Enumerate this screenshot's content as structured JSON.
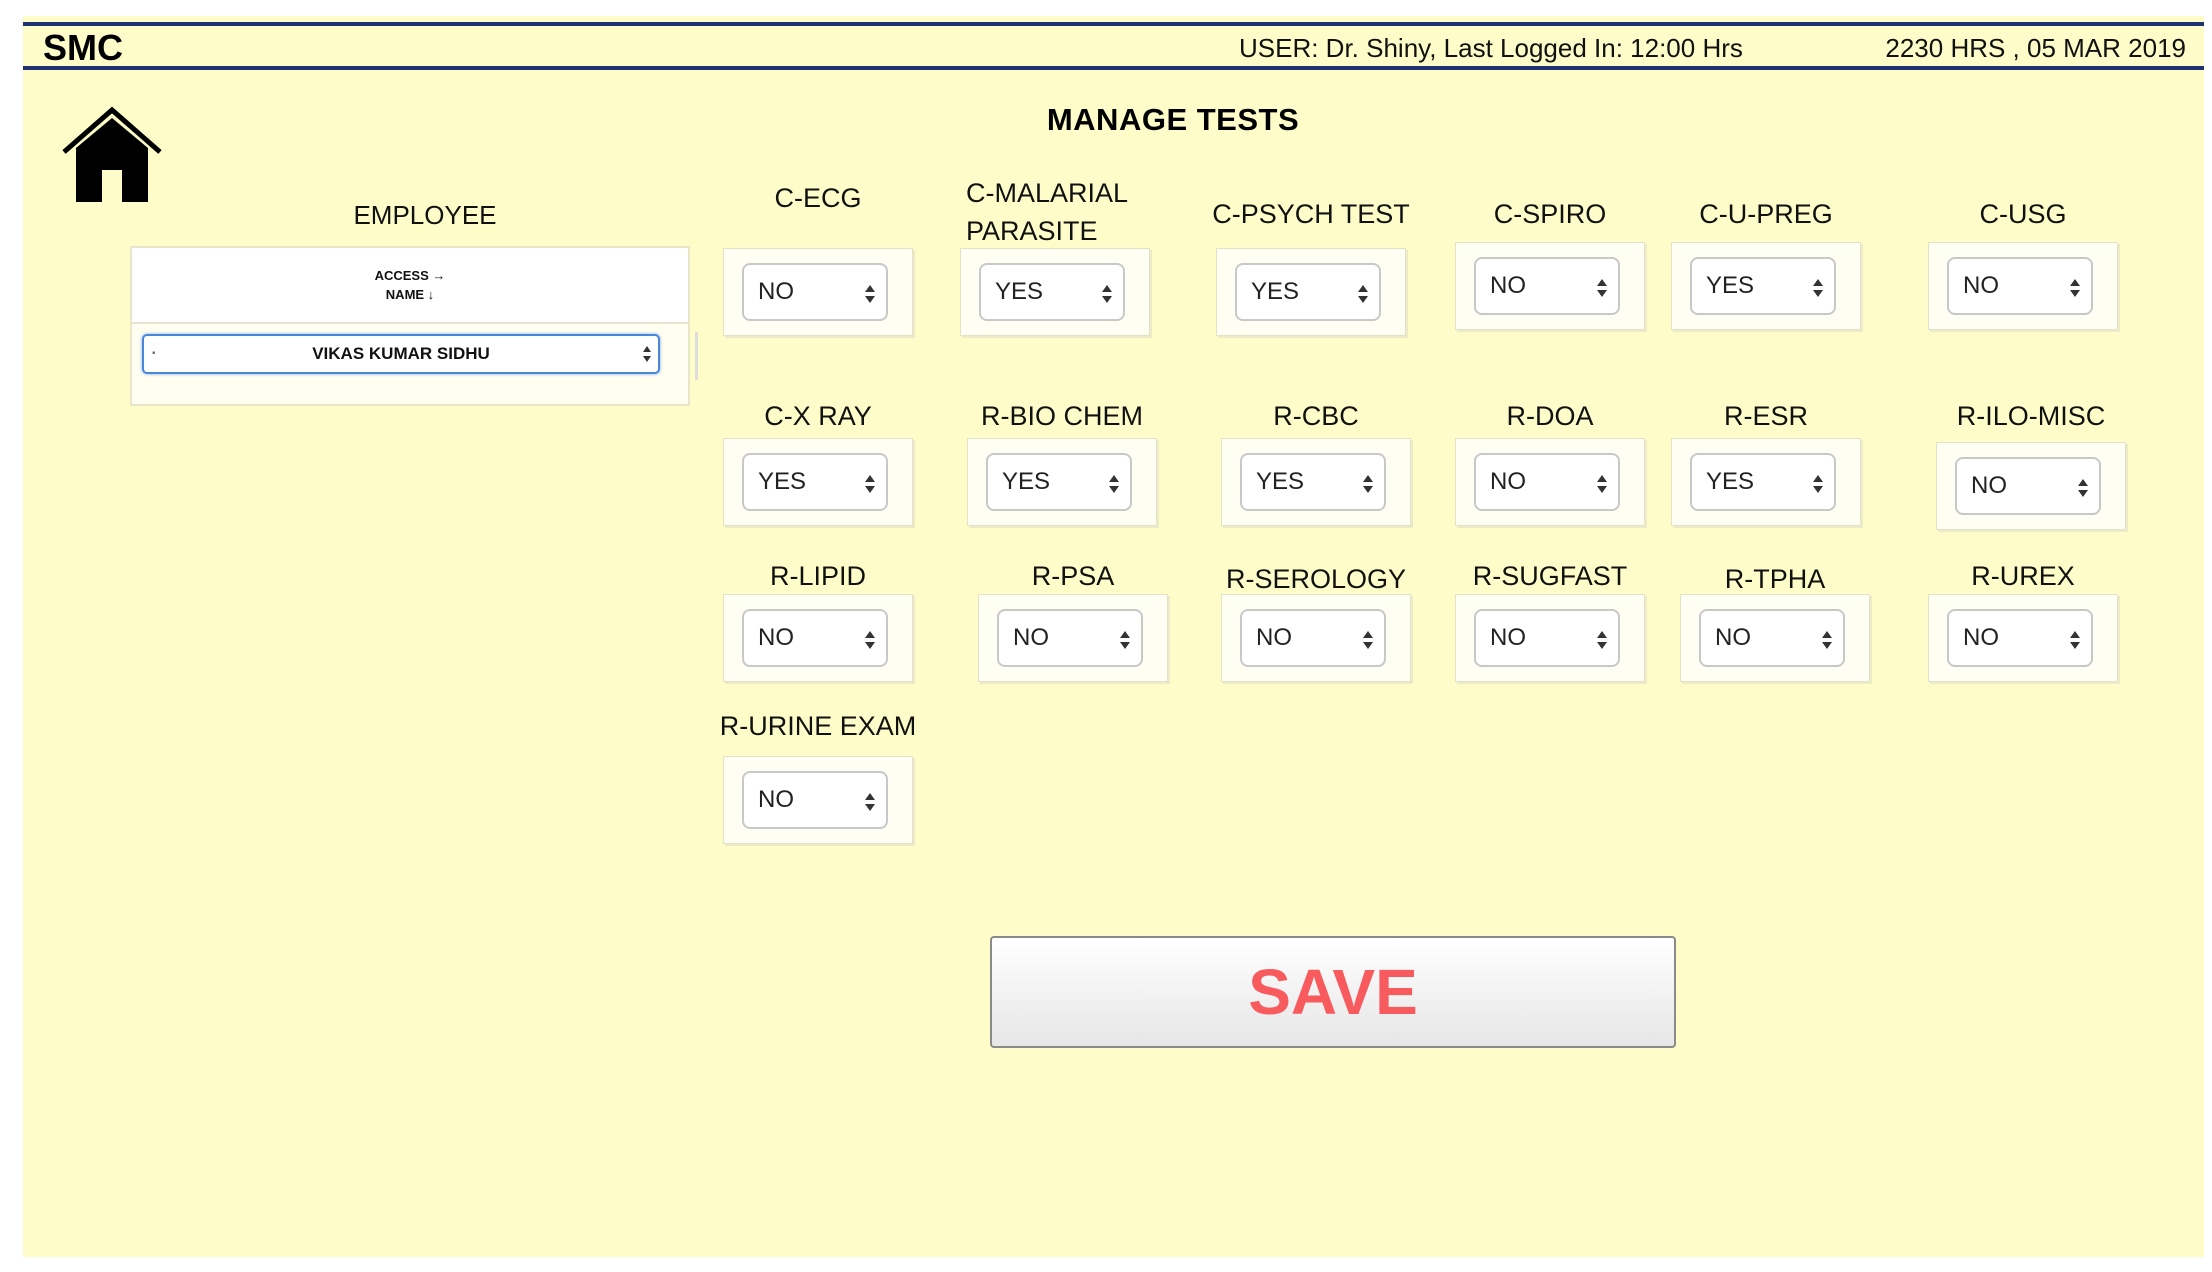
{
  "header": {
    "brand": "SMC",
    "user_info": "USER: Dr. Shiny, Last Logged In: 12:00 Hrs",
    "datetime": "2230 HRS , 05 MAR 2019"
  },
  "page": {
    "title": "MANAGE TESTS"
  },
  "employee": {
    "label": "EMPLOYEE",
    "header_access": "ACCESS →",
    "header_name": "NAME ↓",
    "selected_name": "VIKAS KUMAR SIDHU"
  },
  "tests": [
    {
      "label": "C-ECG",
      "value": "NO"
    },
    {
      "label": "C-MALARIAL PARASITE",
      "value": "YES"
    },
    {
      "label": "C-PSYCH TEST",
      "value": "YES"
    },
    {
      "label": "C-SPIRO",
      "value": "NO"
    },
    {
      "label": "C-U-PREG",
      "value": "YES"
    },
    {
      "label": "C-USG",
      "value": "NO"
    },
    {
      "label": "C-X RAY",
      "value": "YES"
    },
    {
      "label": "R-BIO CHEM",
      "value": "YES"
    },
    {
      "label": "R-CBC",
      "value": "YES"
    },
    {
      "label": "R-DOA",
      "value": "NO"
    },
    {
      "label": "R-ESR",
      "value": "YES"
    },
    {
      "label": "R-ILO-MISC",
      "value": "NO"
    },
    {
      "label": "R-LIPID",
      "value": "NO"
    },
    {
      "label": "R-PSA",
      "value": "NO"
    },
    {
      "label": "R-SEROLOGY",
      "value": "NO"
    },
    {
      "label": "R-SUGFAST",
      "value": "NO"
    },
    {
      "label": "R-TPHA",
      "value": "NO"
    },
    {
      "label": "R-UREX",
      "value": "NO"
    },
    {
      "label": "R-URINE EXAM",
      "value": "NO"
    }
  ],
  "actions": {
    "save_label": "SAVE"
  },
  "colors": {
    "background": "#fefdca",
    "header_rule": "#1f3170",
    "save_text": "#f75b5e"
  }
}
